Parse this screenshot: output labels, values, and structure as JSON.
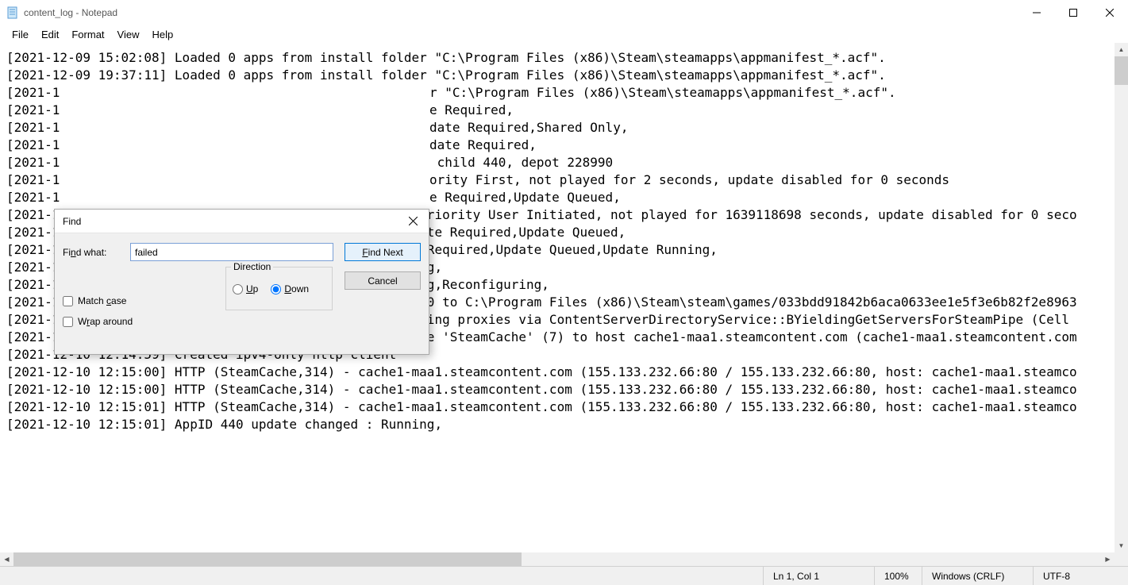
{
  "window": {
    "title": "content_log - Notepad"
  },
  "menu": {
    "file": "File",
    "edit": "Edit",
    "format": "Format",
    "view": "View",
    "help": "Help"
  },
  "text": {
    "l1": "",
    "l2": "[2021-12-09 15:02:08] Loaded 0 apps from install folder \"C:\\Program Files (x86)\\Steam\\steamapps\\appmanifest_*.acf\".",
    "l3": "",
    "l4": "",
    "l5": "[2021-12-09 19:37:11] Loaded 0 apps from install folder \"C:\\Program Files (x86)\\Steam\\steamapps\\appmanifest_*.acf\".",
    "l6": "",
    "l7": "",
    "l8a": "[2021-1",
    "l8b": "r \"C:\\Program Files (x86)\\Steam\\steamapps\\appmanifest_*.acf\".",
    "l9a": "[2021-1",
    "l9b": "e Required,",
    "l10a": "[2021-1",
    "l10b": "date Required,Shared Only,",
    "l11a": "[2021-1",
    "l11b": "date Required,",
    "l12a": "[2021-1",
    "l12b": " child 440, depot 228990",
    "l13a": "[2021-1",
    "l13b": "ority First, not played for 2 seconds, update disabled for 0 seconds",
    "l14a": "[2021-1",
    "l14b": "e Required,Update Queued,",
    "l15": "[2021-12-10 12:14:58] AppID 228980 scheduler update : Priority User Initiated, not played for 1639118698 seconds, update disabled for 0 seco",
    "l16": "[2021-12-10 12:14:58] AppID 228980 state changed : Update Required,Update Queued,",
    "l17": "[2021-12-10 12:14:58] AppID 440 state changed : Update Required,Update Queued,Update Running,",
    "l18": "[2021-12-10 12:14:58] AppID 440 update changed : Running,",
    "l19": "[2021-12-10 12:14:58] AppID 440 update changed : Running,Reconfiguring,",
    "l20": "[2021-12-10 12:14:58] Download system icon for AppID 440 to C:\\Program Files (x86)\\Steam\\steam\\games/033bdd91842b6aca0633ee1e5f3e6b82f2e8963",
    "l21": "[2021-12-10 12:14:59] Got 2 download sources and 0 caching proxies via ContentServerDirectoryService::BYieldingGetServersForSteamPipe (Cell ",
    "l22": "[2021-12-10 12:14:59] Created download interface of type 'SteamCache' (7) to host cache1-maa1.steamcontent.com (cache1-maa1.steamcontent.com",
    "l23": "[2021-12-10 12:14:59] Created ipv4-only http client",
    "l24": "[2021-12-10 12:15:00] HTTP (SteamCache,314) - cache1-maa1.steamcontent.com (155.133.232.66:80 / 155.133.232.66:80, host: cache1-maa1.steamco",
    "l25": "[2021-12-10 12:15:00] HTTP (SteamCache,314) - cache1-maa1.steamcontent.com (155.133.232.66:80 / 155.133.232.66:80, host: cache1-maa1.steamco",
    "l26": "[2021-12-10 12:15:01] HTTP (SteamCache,314) - cache1-maa1.steamcontent.com (155.133.232.66:80 / 155.133.232.66:80, host: cache1-maa1.steamco",
    "l27": "[2021-12-10 12:15:01] AppID 440 update changed : Running,"
  },
  "dialog": {
    "title": "Find",
    "findwhat_label": "Find what:",
    "findwhat_value": "failed",
    "findnext": "Find Next",
    "cancel": "Cancel",
    "direction": "Direction",
    "up": "Up",
    "down": "Down",
    "matchcase": "Match case",
    "wrap": "Wrap around"
  },
  "status": {
    "pos": "Ln 1, Col 1",
    "zoom": "100%",
    "eol": "Windows (CRLF)",
    "enc": "UTF-8"
  }
}
